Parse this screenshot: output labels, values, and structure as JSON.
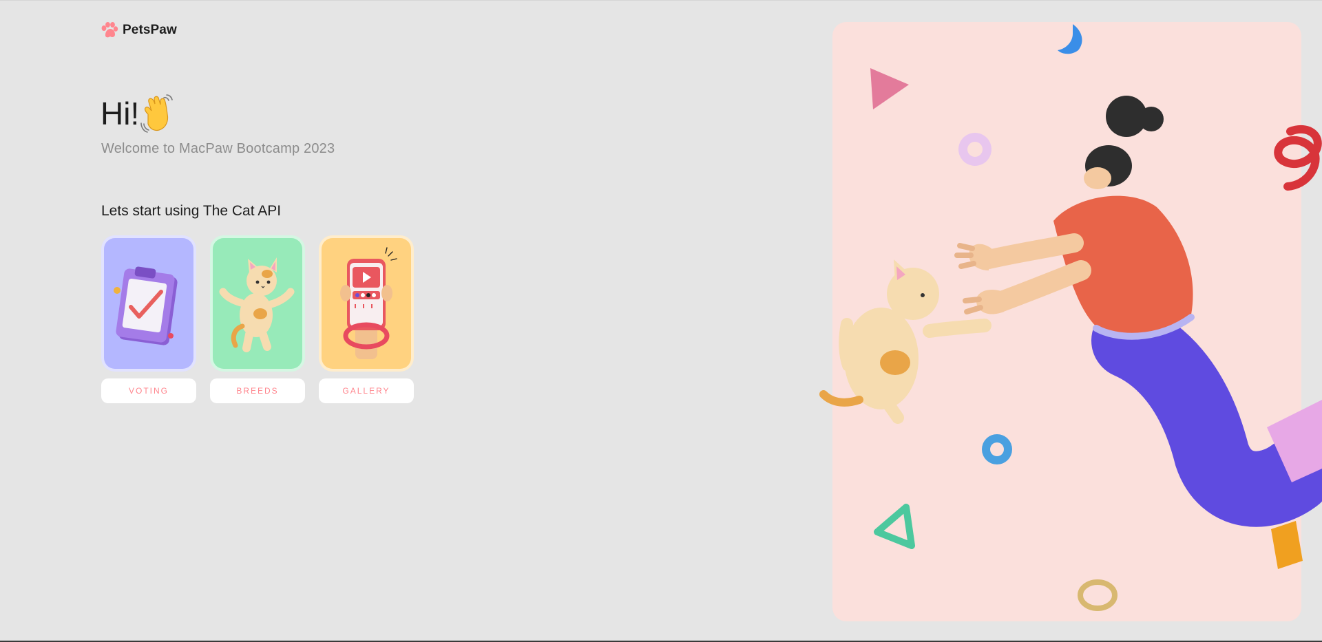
{
  "logo": {
    "icon": "paw-icon",
    "text": "PetsPaw",
    "color": "#ff868e"
  },
  "greeting": {
    "title": "Hi!",
    "icon": "waving-hand-icon",
    "subtitle": "Welcome to MacPaw Bootcamp 2023"
  },
  "section": {
    "heading": "Lets start using The Cat API"
  },
  "cards": [
    {
      "icon": "clipboard-check-icon",
      "label": "VOTING",
      "color": "#b4b7ff"
    },
    {
      "icon": "cat-icon",
      "label": "BREEDS",
      "color": "#97eab9"
    },
    {
      "icon": "phone-gallery-icon",
      "label": "GALLERY",
      "color": "#ffd280"
    }
  ],
  "hero": {
    "panel_color": "#fbe0dc",
    "illustration": "girl-catching-cat-illustration"
  },
  "colors": {
    "background": "#e5e5e5",
    "accent": "#ff868e",
    "text": "#1d1d1d",
    "muted": "#8c8c8c"
  }
}
